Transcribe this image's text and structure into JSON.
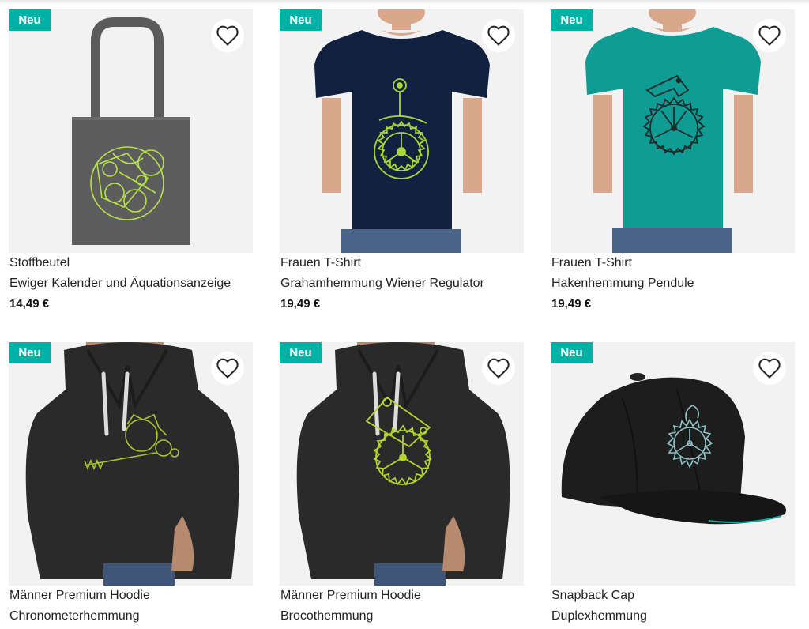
{
  "colors": {
    "badge": "#00b2a5",
    "image_bg": "#f2f2f2"
  },
  "products": [
    {
      "badge": "Neu",
      "type": "Stoffbeutel",
      "name": "Ewiger Kalender und Äquationsanzeige",
      "price": "14,49 €",
      "image_icon": "tote-bag-image",
      "fav_icon": "heart-outline-icon"
    },
    {
      "badge": "Neu",
      "type": "Frauen T-Shirt",
      "name": "Grahamhemmung Wiener Regulator",
      "price": "19,49 €",
      "image_icon": "navy-tshirt-image",
      "fav_icon": "heart-outline-icon"
    },
    {
      "badge": "Neu",
      "type": "Frauen T-Shirt",
      "name": "Hakenhemmung Pendule",
      "price": "19,49 €",
      "image_icon": "teal-tshirt-image",
      "fav_icon": "heart-outline-icon"
    },
    {
      "badge": "Neu",
      "type": "Männer Premium Hoodie",
      "name": "Chronometerhemmung",
      "image_icon": "hoodie-image",
      "fav_icon": "heart-outline-icon"
    },
    {
      "badge": "Neu",
      "type": "Männer Premium Hoodie",
      "name": "Brocothemmung",
      "image_icon": "hoodie-image",
      "fav_icon": "heart-outline-icon"
    },
    {
      "badge": "Neu",
      "type": "Snapback Cap",
      "name": "Duplexhemmung",
      "image_icon": "snapback-cap-image",
      "fav_icon": "heart-outline-icon"
    }
  ]
}
